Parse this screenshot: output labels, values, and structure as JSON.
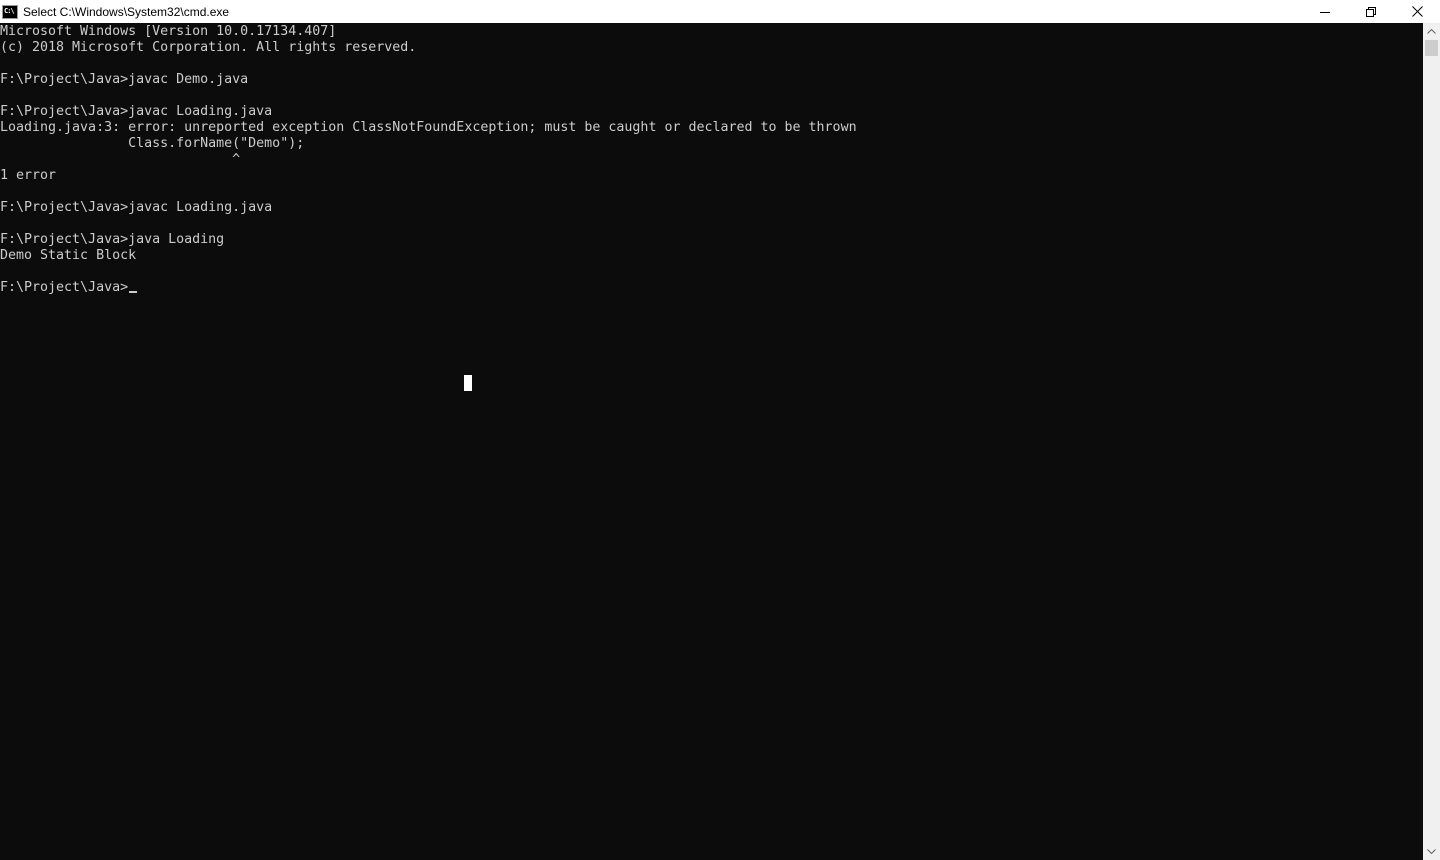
{
  "window": {
    "title": "Select C:\\Windows\\System32\\cmd.exe",
    "icon_label": "C:\\",
    "icon": "cmd-icon",
    "controls": {
      "minimize": "minimize-icon",
      "restore": "restore-icon",
      "close": "close-icon"
    }
  },
  "console": {
    "background": "#0c0c0c",
    "foreground": "#cccccc",
    "lines": [
      "Microsoft Windows [Version 10.0.17134.407]",
      "(c) 2018 Microsoft Corporation. All rights reserved.",
      "",
      "F:\\Project\\Java>javac Demo.java",
      "",
      "F:\\Project\\Java>javac Loading.java",
      "Loading.java:3: error: unreported exception ClassNotFoundException; must be caught or declared to be thrown",
      "                Class.forName(\"Demo\");",
      "                             ^",
      "1 error",
      "",
      "F:\\Project\\Java>javac Loading.java",
      "",
      "F:\\Project\\Java>java Loading",
      "Demo Static Block",
      "",
      "F:\\Project\\Java>"
    ]
  },
  "scrollbar": {
    "up_icon": "scroll-up-arrow-icon",
    "down_icon": "scroll-down-arrow-icon"
  }
}
